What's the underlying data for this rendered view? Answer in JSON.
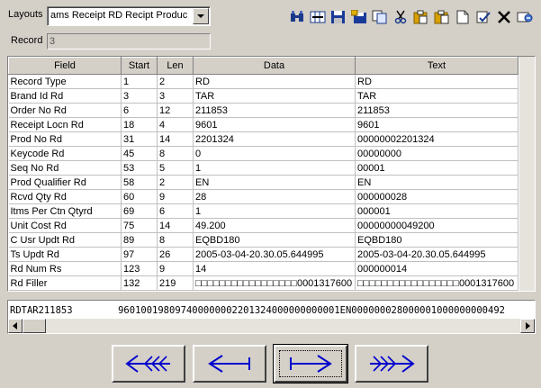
{
  "header": {
    "layouts_label": "Layouts",
    "layouts_value": "ams Receipt RD Recipt Product",
    "record_label": "Record",
    "record_value": "3"
  },
  "toolbar": {
    "icons": [
      "binoculars-icon",
      "column-grid-icon",
      "save-icon",
      "save-as-icon",
      "copy-record-icon",
      "cut-icon",
      "copy-icon",
      "paste-icon",
      "new-document-icon",
      "edit-check-icon",
      "delete-x-icon",
      "wizard-icon"
    ]
  },
  "table": {
    "headers": [
      "Field",
      "Start",
      "Len",
      "Data",
      "Text"
    ],
    "rows": [
      [
        "Record Type",
        "1",
        "2",
        "RD",
        "RD"
      ],
      [
        "Brand Id Rd",
        "3",
        "3",
        "TAR",
        "TAR"
      ],
      [
        "Order No Rd",
        "6",
        "12",
        "211853",
        "211853"
      ],
      [
        "Receipt Locn Rd",
        "18",
        "4",
        "9601",
        "9601"
      ],
      [
        "Prod No Rd",
        "31",
        "14",
        "2201324",
        "00000002201324"
      ],
      [
        "Keycode Rd",
        "45",
        "8",
        "0",
        "00000000"
      ],
      [
        "Seq No Rd",
        "53",
        "5",
        "1",
        "00001"
      ],
      [
        "Prod Qualifier Rd",
        "58",
        "2",
        "EN",
        "EN"
      ],
      [
        "Rcvd Qty Rd",
        "60",
        "9",
        "28",
        "000000028"
      ],
      [
        "Itms Per Ctn Qtyrd",
        "69",
        "6",
        "1",
        "000001"
      ],
      [
        "Unit Cost Rd",
        "75",
        "14",
        "49.200",
        "00000000049200"
      ],
      [
        "C Usr Updt Rd",
        "89",
        "8",
        "EQBD180",
        "EQBD180"
      ],
      [
        "Ts Updt Rd",
        "97",
        "26",
        "2005-03-04-20.30.05.644995",
        "2005-03-04-20.30.05.644995"
      ],
      [
        "Rd Num Rs",
        "123",
        "9",
        "14",
        "000000014"
      ],
      [
        "Rd Filler",
        "132",
        "219",
        "□□□□□□□□□□□□□□□□□0001317600",
        "□□□□□□□□□□□□□□□□□0001317600"
      ]
    ]
  },
  "raw_record": "RDTAR211853        960100198097400000002201324000000000001EN000000028000001000000000492",
  "nav": {
    "buttons": [
      "first-record-icon",
      "previous-record-icon",
      "next-record-icon",
      "last-record-icon"
    ],
    "arrow_color": "#0000cc"
  }
}
